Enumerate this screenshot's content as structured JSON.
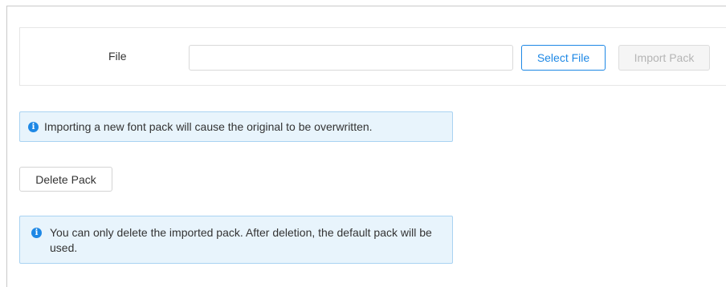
{
  "file_section": {
    "label": "File",
    "input_value": "",
    "select_button": "Select File",
    "import_button": "Import Pack"
  },
  "notices": {
    "import_warning": "Importing a new font pack will cause the original to be overwritten.",
    "delete_info": "You can only delete the imported pack. After deletion, the default pack will be used."
  },
  "actions": {
    "delete_button": "Delete Pack"
  },
  "icons": {
    "info": "info-icon",
    "info_glyph": "i"
  },
  "colors": {
    "accent": "#1e88e5",
    "notice_bg": "#e8f4fc",
    "notice_border": "#a9d3f2",
    "disabled_text": "#b5b5b5"
  }
}
